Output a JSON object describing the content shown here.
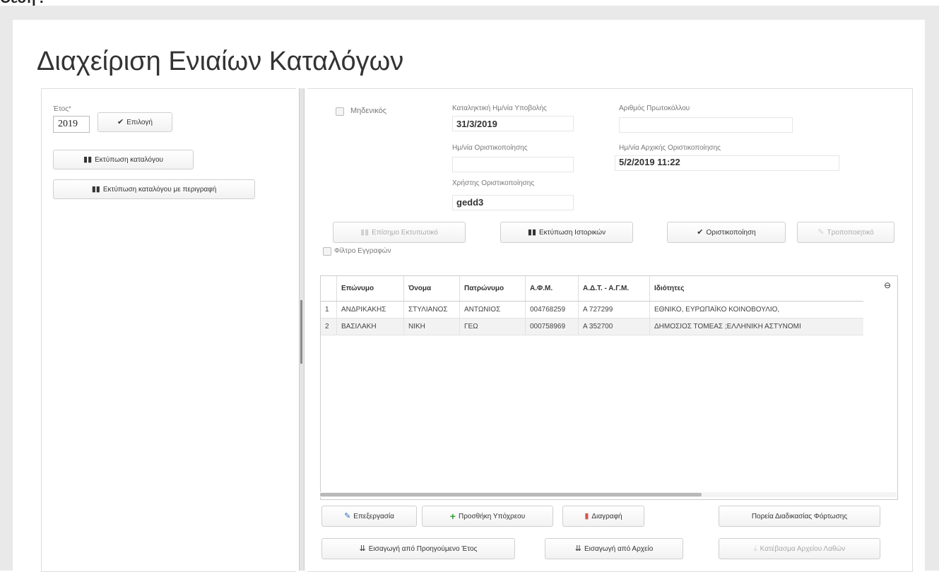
{
  "top": {
    "fragment": "Θέση ."
  },
  "page": {
    "title": "Διαχείριση Ενιαίων Καταλόγων"
  },
  "left": {
    "year_label": "Έτος",
    "year_required_mark": "*",
    "year_value": "2019",
    "select_label": "Επιλογή",
    "print_catalog_label": "Εκτύπωση καταλόγου",
    "print_catalog_desc_label": "Εκτύπωση καταλόγου με περιγραφή"
  },
  "form": {
    "zero_label": "Μηδενικός",
    "deadline_label": "Καταληκτική Ημ/νία Υποβολής",
    "deadline_value": "31/3/2019",
    "protocol_label": "Αριθμός Πρωτοκόλλου",
    "protocol_value": "",
    "finalize_date_label": "Ημ/νία Οριστικοποίησης",
    "finalize_date_value": "",
    "initial_finalize_label": "Ημ/νία Αρχικής Οριστικοποίησης",
    "initial_finalize_value": "5/2/2019 11:22",
    "finalize_user_label": "Χρήστης Οριστικοποίησης",
    "finalize_user_value": "gedd3"
  },
  "toolbar": {
    "official_print": "Επίσημο Εκτυπωτικό",
    "history_print": "Εκτύπωση Ιστορικών",
    "finalize": "Οριστικοποίηση",
    "amendment": "Τροποποιητικό",
    "filter_label": "Φίλτρο Εγγραφών"
  },
  "grid": {
    "columns": [
      "",
      "Επώνυμο",
      "Όνομα",
      "Πατρώνυμο",
      "Α.Φ.Μ.",
      "Α.Δ.Τ. - Α.Γ.Μ.",
      "Ιδιότητες"
    ],
    "rows": [
      [
        "1",
        "ΑΝΔΡΙΚΑΚΗΣ",
        "ΣΤΥΛΙΑΝΟΣ",
        "ΑΝΤΩΝΙΟΣ",
        "004768259",
        "Α 727299",
        "ΕΘΝΙΚΟ, ΕΥΡΩΠΑΪΚΟ ΚΟΙΝΟΒΟΥΛΙΟ,"
      ],
      [
        "2",
        "ΒΑΣΙΛΑΚΗ",
        "ΝΙΚΗ",
        "ΓΕΩ",
        "000758969",
        "Α 352700",
        "ΔΗΜΟΣΙΟΣ ΤΟΜΕΑΣ ;ΕΛΛΗΝΙΚΗ ΑΣΤΥΝΟΜΙ"
      ]
    ]
  },
  "actions": {
    "edit": "Επεξεργασία",
    "add": "Προσθήκη Υπόχρεου",
    "delete": "Διαγραφή",
    "load_progress": "Πορεία Διαδικασίας Φόρτωσης",
    "import_prev": "Εισαγωγή από Προηγούμενο Έτος",
    "import_file": "Εισαγωγή από Αρχείο",
    "download_errors": "Κατέβασμα Αρχείου Λαθών"
  },
  "colors": {
    "accent_green": "#3a9a3a",
    "accent_red": "#d9534f",
    "accent_blue": "#2a6ebb"
  }
}
